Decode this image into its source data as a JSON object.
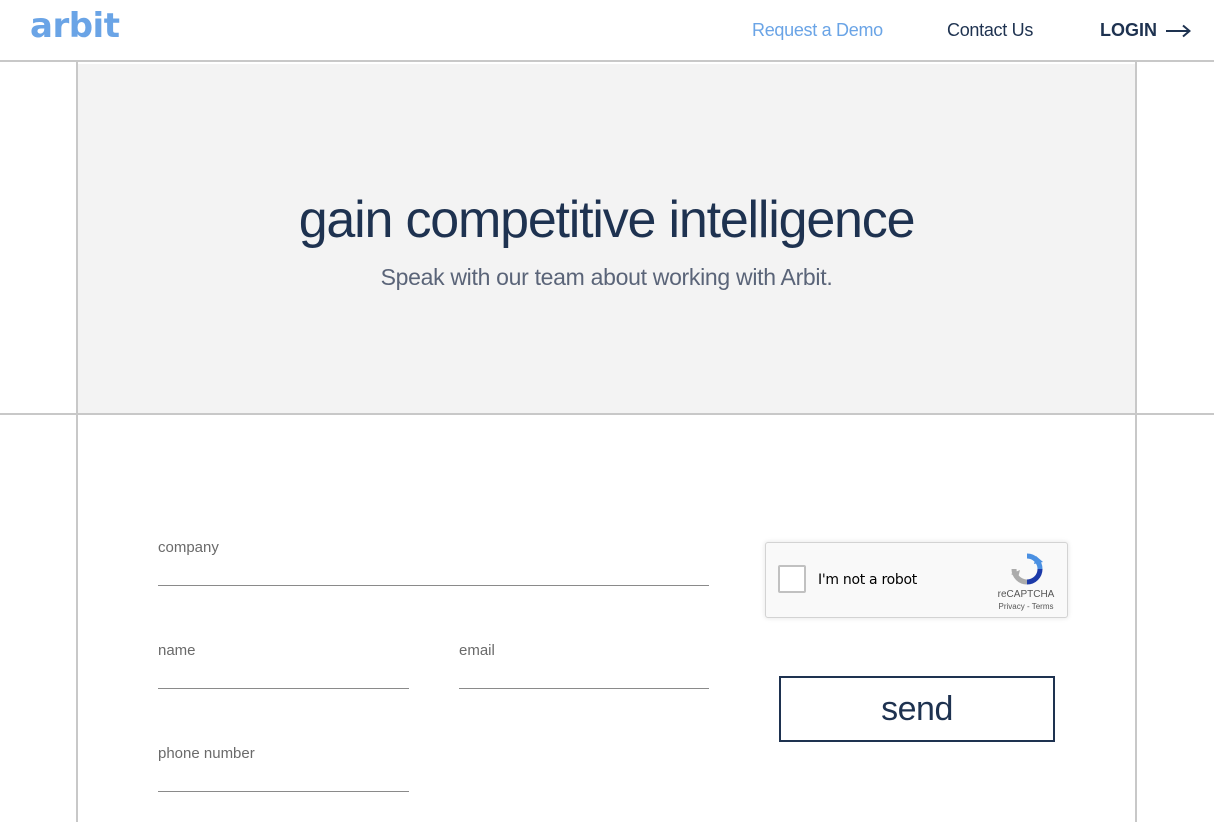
{
  "header": {
    "logo_text": "arbit",
    "nav": {
      "request_demo": "Request a Demo",
      "contact": "Contact Us",
      "login": "LOGIN"
    }
  },
  "hero": {
    "title": "gain competitive intelligence",
    "subtitle": "Speak with our team about working with Arbit."
  },
  "form": {
    "company_label": "company",
    "name_label": "name",
    "email_label": "email",
    "phone_label": "phone number",
    "company_value": "",
    "name_value": "",
    "email_value": "",
    "phone_value": "",
    "send_label": "send"
  },
  "captcha": {
    "checkbox_label": "I'm not a robot",
    "brand": "reCAPTCHA",
    "links": "Privacy - Terms",
    "checked": false
  },
  "colors": {
    "accent": "#6aa4e6",
    "navy": "#1e3250",
    "hero_bg": "#f3f3f3",
    "grid_line": "#c8c8c8"
  },
  "icons": [
    "arrow-right-icon",
    "recaptcha-logo-icon"
  ]
}
